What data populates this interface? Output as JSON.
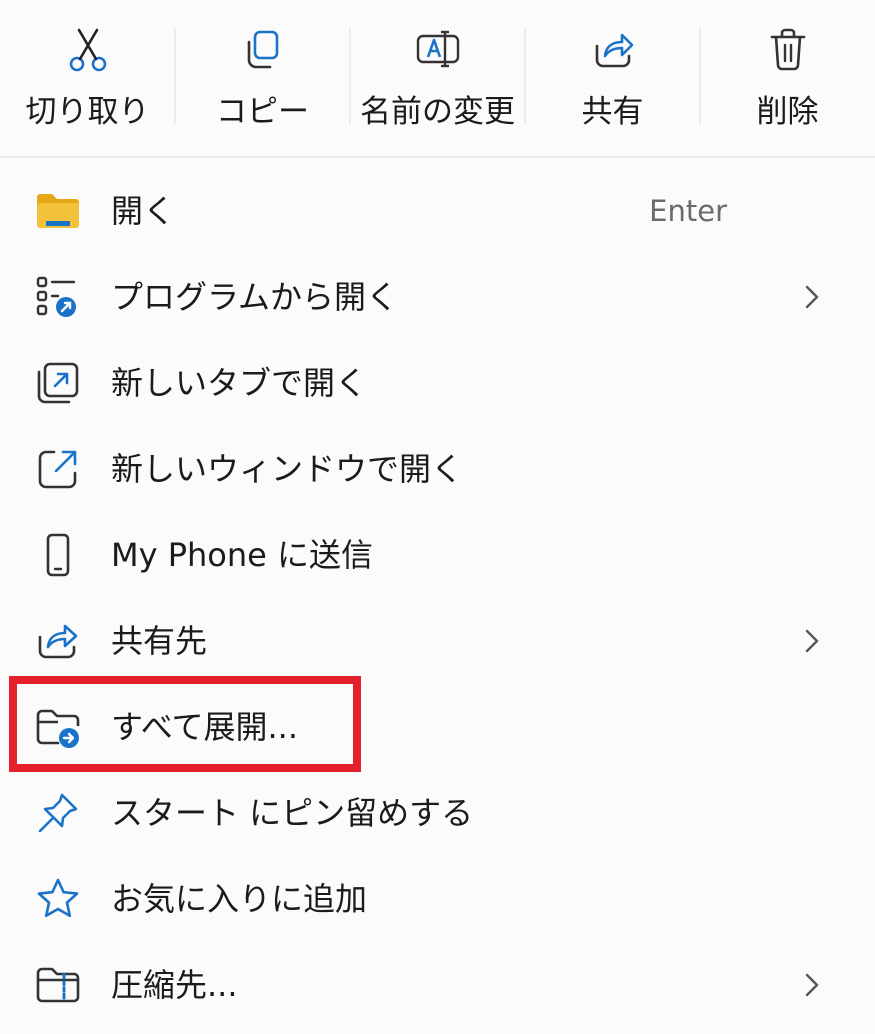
{
  "toolbar": {
    "cut_label": "切り取り",
    "copy_label": "コピー",
    "rename_label": "名前の変更",
    "share_label": "共有",
    "delete_label": "削除"
  },
  "items": [
    {
      "label": "開く",
      "shortcut": "Enter",
      "icon": "folder-icon"
    },
    {
      "label": "プログラムから開く",
      "icon": "open-with-icon",
      "submenu": true
    },
    {
      "label": "新しいタブで開く",
      "icon": "new-tab-icon"
    },
    {
      "label": "新しいウィンドウで開く",
      "icon": "new-window-icon"
    },
    {
      "label": "My Phone に送信",
      "icon": "phone-icon"
    },
    {
      "label": "共有先",
      "icon": "share-icon",
      "submenu": true
    },
    {
      "label": "すべて展開...",
      "icon": "extract-folder-icon",
      "highlighted": true
    },
    {
      "label": "スタート にピン留めする",
      "icon": "pin-icon"
    },
    {
      "label": "お気に入りに追加",
      "icon": "star-icon"
    },
    {
      "label": "圧縮先...",
      "icon": "zip-folder-icon",
      "submenu": true
    }
  ],
  "colors": {
    "accent": "#1a73c9",
    "highlight": "#e3202c",
    "folder_yellow": "#f3c13a"
  }
}
